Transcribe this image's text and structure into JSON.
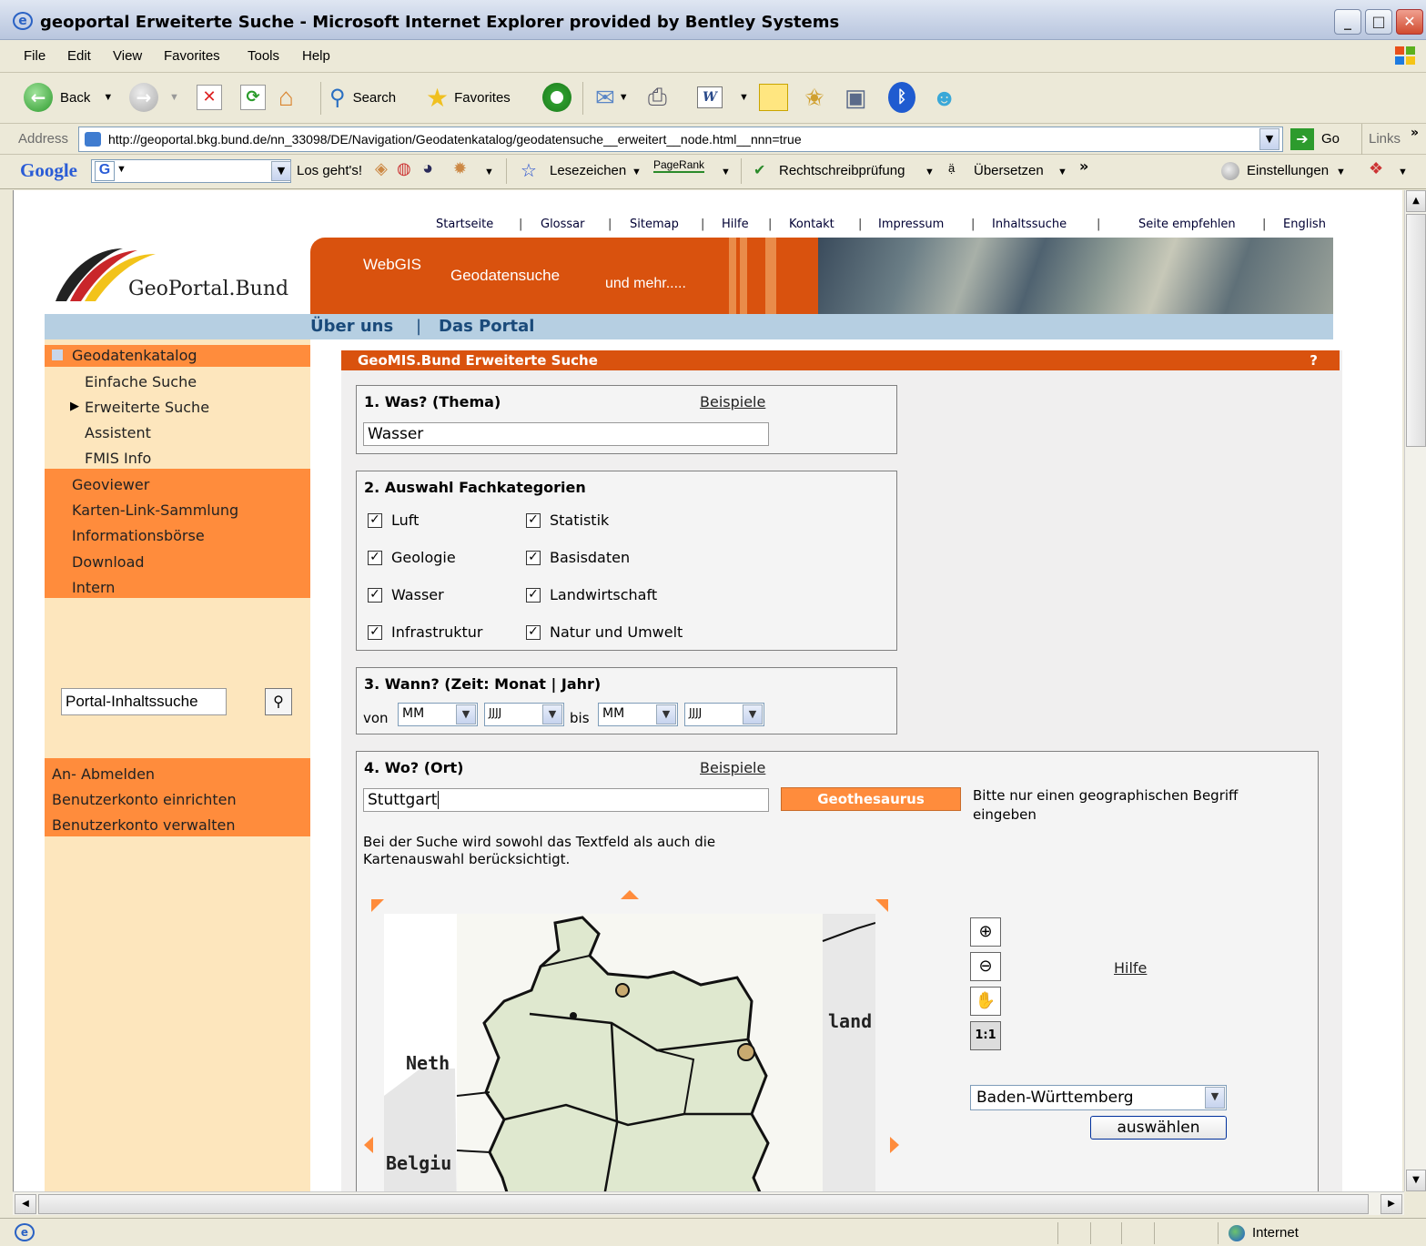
{
  "window": {
    "title": "geoportal Erweiterte Suche - Microsoft Internet Explorer provided by Bentley Systems"
  },
  "menu": [
    "File",
    "Edit",
    "View",
    "Favorites",
    "Tools",
    "Help"
  ],
  "toolbar": {
    "back": "Back",
    "search": "Search",
    "favorites": "Favorites"
  },
  "address": {
    "label": "Address",
    "url": "http://geoportal.bkg.bund.de/nn_33098/DE/Navigation/Geodatenkatalog/geodatensuche__erweitert__node.html__nnn=true",
    "go": "Go",
    "links": "Links"
  },
  "googlebar": {
    "logo": "Google",
    "go": "Los geht's!",
    "bookmarks": "Lesezeichen",
    "pagerank": "PageRank",
    "spell": "Rechtschreibprüfung",
    "translate": "Übersetzen",
    "settings": "Einstellungen"
  },
  "page": {
    "toplinks": [
      "Startseite",
      "Glossar",
      "Sitemap",
      "Hilfe",
      "Kontakt",
      "Impressum",
      "Inhaltssuche",
      "Seite empfehlen",
      "English"
    ],
    "logo_text": "GeoPortal.Bund",
    "banner": {
      "webgis": "WebGIS",
      "geodatensuche": "Geodatensuche",
      "mehr": "und mehr....."
    },
    "nav": [
      "Über uns",
      "Das Portal"
    ],
    "sidebar": {
      "section": "Geodatenkatalog",
      "sub": [
        "Einfache Suche",
        "Erweiterte Suche",
        "Assistent",
        "FMIS Info"
      ],
      "items": [
        "Geoviewer",
        "Karten-Link-Sammlung",
        "Informationsbörse",
        "Download",
        "Intern"
      ],
      "search_placeholder": "Portal-Inhaltssuche",
      "account": [
        "An- Abmelden",
        "Benutzerkonto einrichten",
        "Benutzerkonto verwalten"
      ]
    },
    "main": {
      "header": "GeoMIS.Bund Erweiterte Suche",
      "help": "?",
      "what": {
        "title": "1. Was? (Thema)",
        "examples": "Beispiele",
        "value": "Wasser"
      },
      "categories": {
        "title": "2. Auswahl Fachkategorien",
        "items": [
          "Luft",
          "Statistik",
          "Geologie",
          "Basisdaten",
          "Wasser",
          "Landwirtschaft",
          "Infrastruktur",
          "Natur und Umwelt"
        ]
      },
      "when": {
        "title": "3. Wann? (Zeit: Monat | Jahr)",
        "from": "von",
        "to": "bis",
        "month": "MM",
        "year": "JJJJ"
      },
      "where": {
        "title": "4. Wo? (Ort)",
        "examples": "Beispiele",
        "value": "Stuttgart",
        "thesaurus": "Geothesaurus",
        "hint": "Bitte nur einen geographischen Begriff eingeben",
        "note": "Bei der Suche wird sowohl das Textfeld als auch die Kartenauswahl berücksichtigt.",
        "help": "Hilfe",
        "region": "Baden-Württemberg",
        "select": "auswählen",
        "map_labels": [
          "land",
          "Neth",
          "Belgiu"
        ],
        "zoom_tool": "1:1"
      }
    }
  },
  "status": {
    "zone": "Internet"
  }
}
